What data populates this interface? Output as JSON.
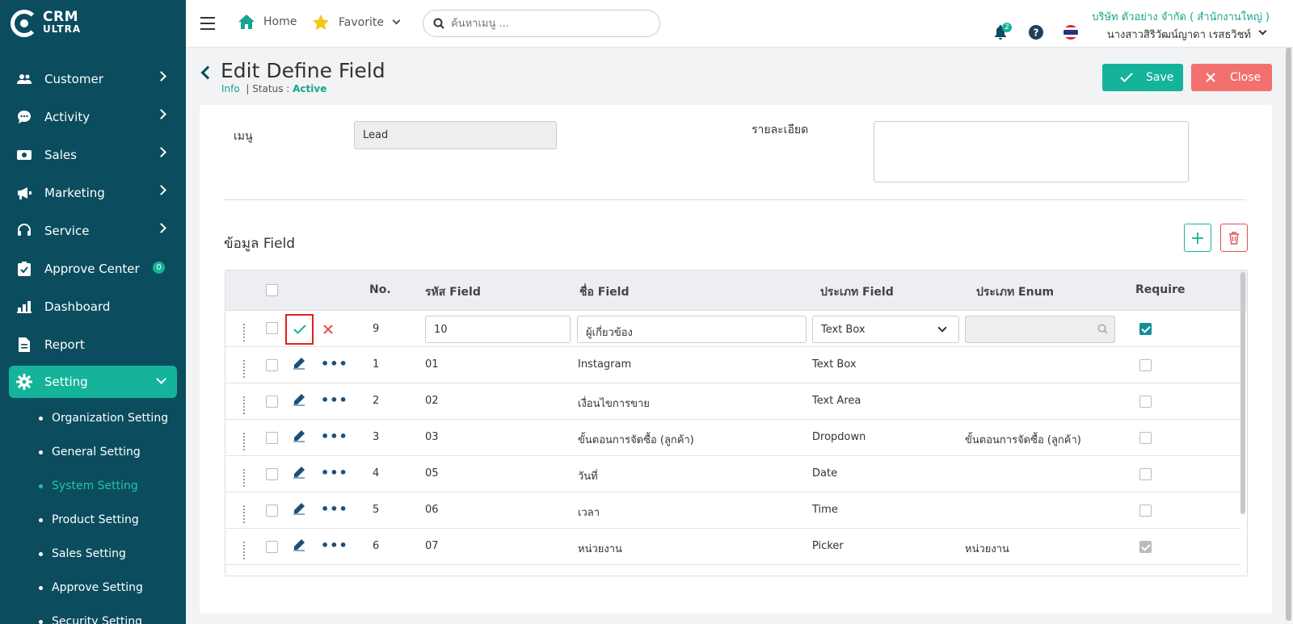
{
  "app": {
    "logo_line1": "CRM",
    "logo_line2": "ULTRA"
  },
  "sidebar": {
    "items": [
      {
        "label": "Customer",
        "icon": "users-icon"
      },
      {
        "label": "Activity",
        "icon": "chat-icon"
      },
      {
        "label": "Sales",
        "icon": "money-icon"
      },
      {
        "label": "Marketing",
        "icon": "megaphone-icon"
      },
      {
        "label": "Service",
        "icon": "headset-icon"
      },
      {
        "label": "Approve Center",
        "icon": "check-clipboard-icon",
        "badge": "0"
      },
      {
        "label": "Dashboard",
        "icon": "bar-chart-icon"
      },
      {
        "label": "Report",
        "icon": "document-icon"
      },
      {
        "label": "Setting",
        "icon": "gear-icon"
      }
    ],
    "sub_items": [
      "Organization Setting",
      "General Setting",
      "System Setting",
      "Product Setting",
      "Sales Setting",
      "Approve Setting",
      "Security Setting"
    ],
    "current_sub": "System Setting"
  },
  "topbar": {
    "home_label": "Home",
    "favorite_label": "Favorite",
    "search_placeholder": "ค้นหาเมนู ...",
    "notification_count": "2",
    "company": "บริษัท ตัวอย่าง จำกัด ( สำนักงานใหญ่ )",
    "user": "นางสาวสิริวัฒน์ญาดา เรสธวิชท์"
  },
  "page": {
    "title": "Edit Define Field",
    "info_label": "Info",
    "status_label": "| Status : ",
    "status_value": "Active",
    "save_label": "Save",
    "close_label": "Close"
  },
  "form": {
    "menu_label": "เมนู",
    "menu_value": "Lead",
    "detail_label": "รายละเอียด",
    "detail_value": ""
  },
  "fields_section": {
    "title": "ข้อมูล Field",
    "headers": {
      "no": "No.",
      "code": "รหัส Field",
      "name": "ชื่อ Field",
      "type": "ประเภท Field",
      "enum": "ประเภท Enum",
      "require": "Require"
    },
    "edit_row": {
      "no": "9",
      "code": "10",
      "name": "ผู้เกี่ยวข้อง",
      "type": "Text Box",
      "enum": "",
      "require": true
    },
    "rows": [
      {
        "no": "1",
        "code": "01",
        "name": "Instagram",
        "type": "Text Box",
        "enum": "",
        "require": false
      },
      {
        "no": "2",
        "code": "02",
        "name": "เงื่อนไขการขาย",
        "type": "Text Area",
        "enum": "",
        "require": false
      },
      {
        "no": "3",
        "code": "03",
        "name": "ขั้นตอนการจัดซื้อ (ลูกค้า)",
        "type": "Dropdown",
        "enum": "ขั้นตอนการจัดซื้อ (ลูกค้า)",
        "require": false
      },
      {
        "no": "4",
        "code": "05",
        "name": "วันที่",
        "type": "Date",
        "enum": "",
        "require": false
      },
      {
        "no": "5",
        "code": "06",
        "name": "เวลา",
        "type": "Time",
        "enum": "",
        "require": false
      },
      {
        "no": "6",
        "code": "07",
        "name": "หน่วยงาน",
        "type": "Picker",
        "enum": "หน่วยงาน",
        "require": true
      }
    ]
  },
  "colors": {
    "sidebar": "#0b4d5e",
    "accent": "#15b39a",
    "danger": "#f2706d"
  }
}
